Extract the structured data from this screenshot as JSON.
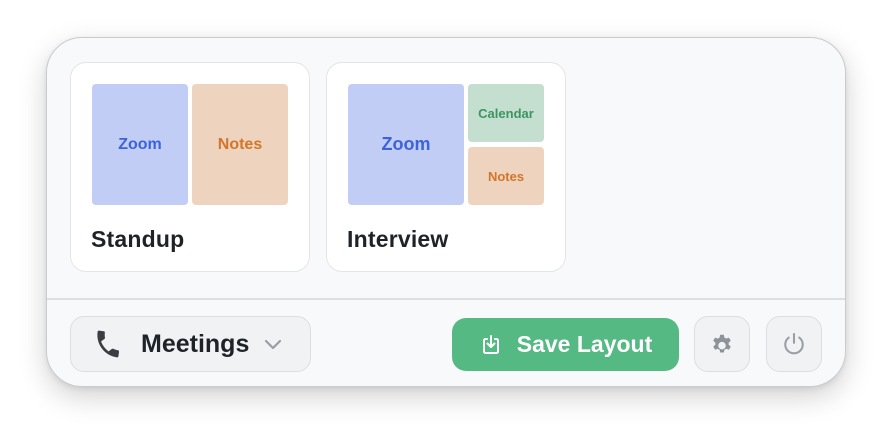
{
  "layouts": [
    {
      "title": "Standup",
      "panes": [
        "Zoom",
        "Notes"
      ]
    },
    {
      "title": "Interview",
      "panes": [
        "Zoom",
        "Calendar",
        "Notes"
      ]
    }
  ],
  "footer": {
    "profile_label": "Meetings",
    "profile_icon": "phone-icon",
    "save_label": "Save Layout",
    "save_icon": "save-download-icon",
    "settings_icon": "gear-icon",
    "power_icon": "power-icon"
  },
  "colors": {
    "zoom_fill": "#c1cdf5",
    "zoom_text": "#3d63d8",
    "notes_fill": "#eed4be",
    "notes_text": "#d2762a",
    "calendar_fill": "#c4ded0",
    "calendar_text": "#3c9561",
    "save_button": "#55b983"
  }
}
